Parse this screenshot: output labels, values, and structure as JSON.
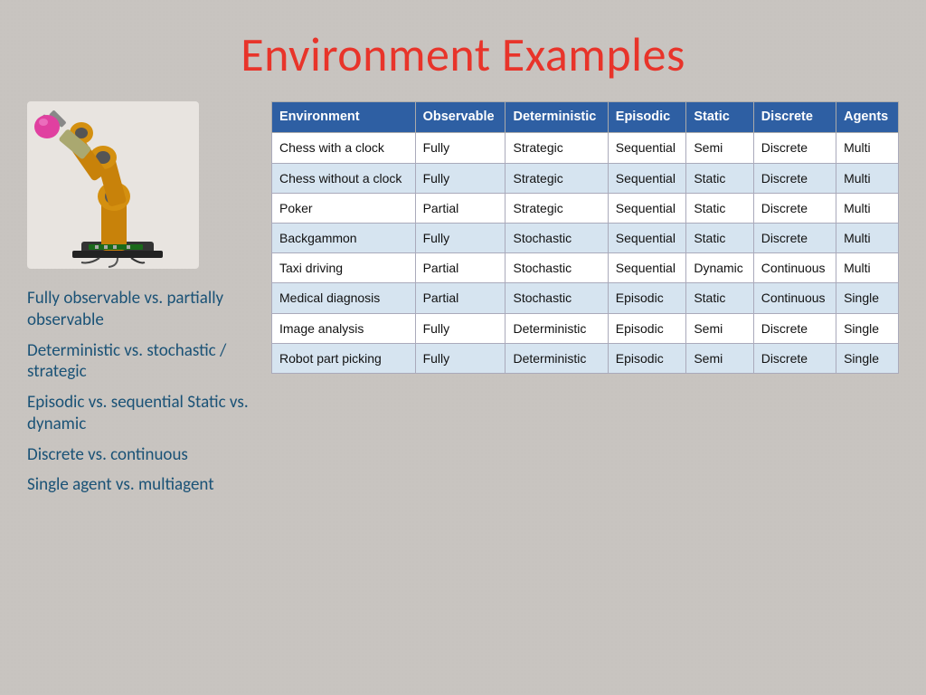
{
  "page": {
    "title": "Environment Examples",
    "background_color": "#c8c4c0"
  },
  "left_panel": {
    "bullets": [
      "Fully observable vs. partially observable",
      "Deterministic vs. stochastic / strategic",
      "Episodic vs. sequential Static vs. dynamic",
      "Discrete vs. continuous",
      "Single agent vs. multiagent"
    ]
  },
  "table": {
    "headers": [
      "Environment",
      "Obser vable",
      "Determi nistic",
      "Episodic",
      "Static",
      "Discrete",
      "Agents"
    ],
    "rows": [
      [
        "Chess with a clock",
        "Fully",
        "Strategic",
        "Sequential",
        "Semi",
        "Discrete",
        "Multi"
      ],
      [
        "Chess without a clock",
        "Fully",
        "Strategic",
        "Sequential",
        "Static",
        "Discrete",
        "Multi"
      ],
      [
        "Poker",
        "Partial",
        "Strategic",
        "Sequential",
        "Static",
        "Discrete",
        "Multi"
      ],
      [
        "Backgammon",
        "Fully",
        "Stochastic",
        "Sequential",
        "Static",
        "Discrete",
        "Multi"
      ],
      [
        "Taxi driving",
        "Partial",
        "Stochastic",
        "Sequential",
        "Dynamic",
        "Continuous",
        "Multi"
      ],
      [
        "Medical diagnosis",
        "Partial",
        "Stochastic",
        "Episodic",
        "Static",
        "Continuous",
        "Single"
      ],
      [
        "Image analysis",
        "Fully",
        "Deterministic",
        "Episodic",
        "Semi",
        "Discrete",
        "Single"
      ],
      [
        "Robot part picking",
        "Fully",
        "Deterministic",
        "Episodic",
        "Semi",
        "Discrete",
        "Single"
      ]
    ]
  }
}
